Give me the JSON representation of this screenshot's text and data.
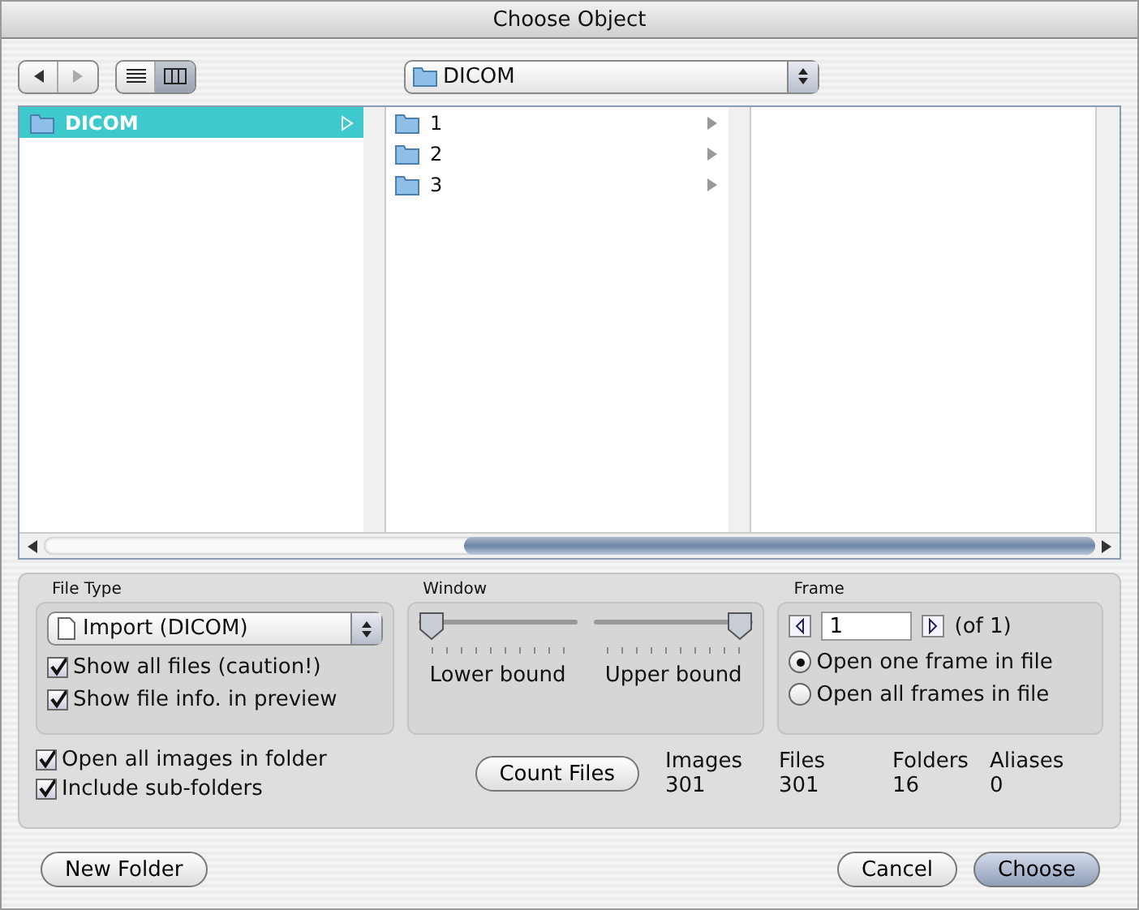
{
  "window": {
    "title": "Choose Object"
  },
  "toolbar": {
    "views": [
      {
        "kind": "list",
        "selected": false
      },
      {
        "kind": "columns",
        "selected": true
      }
    ],
    "path": "DICOM"
  },
  "browser": {
    "columns": [
      {
        "items": [
          {
            "name": "DICOM",
            "selected": true
          }
        ]
      },
      {
        "items": [
          {
            "name": "1",
            "selected": false
          },
          {
            "name": "2",
            "selected": false
          },
          {
            "name": "3",
            "selected": false
          }
        ]
      }
    ]
  },
  "file_type": {
    "label": "File Type",
    "value": "Import (DICOM)",
    "options": [
      {
        "label": "Show all files (caution!)",
        "checked": true
      },
      {
        "label": "Show file info. in preview",
        "checked": true
      }
    ]
  },
  "window_panel": {
    "label": "Window",
    "sliders": [
      {
        "label": "Lower bound",
        "level": 0
      },
      {
        "label": "Upper bound",
        "level": 1
      }
    ]
  },
  "frame": {
    "label": "Frame",
    "value": "1",
    "of": "(of 1)",
    "modes": [
      {
        "label": "Open one frame in file",
        "selected": true
      },
      {
        "label": "Open all frames in file",
        "selected": false
      }
    ]
  },
  "folder_options": [
    {
      "label": "Open all images in folder",
      "checked": true
    },
    {
      "label": "Include sub-folders",
      "checked": true
    }
  ],
  "count_button": "Count Files",
  "stats": [
    {
      "label": "Images",
      "value": "301"
    },
    {
      "label": "Files",
      "value": "301"
    },
    {
      "label": "Folders",
      "value": "16"
    },
    {
      "label": "Aliases",
      "value": "0"
    }
  ],
  "buttons": [
    {
      "label": "New Folder",
      "default": false
    },
    {
      "label": "Cancel",
      "default": false
    },
    {
      "label": "Choose",
      "default": true
    }
  ]
}
